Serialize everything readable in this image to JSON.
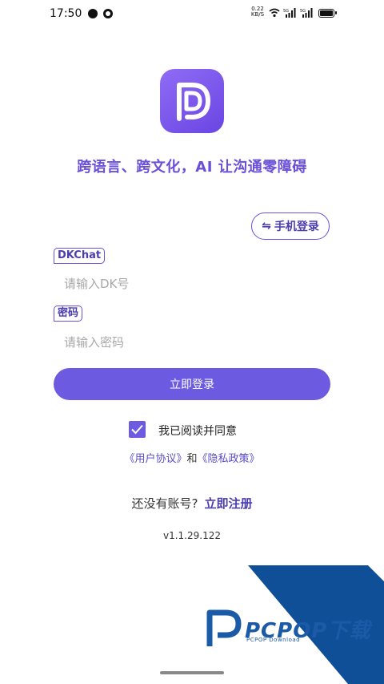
{
  "status_bar": {
    "time": "17:50",
    "net_speed": "0.22",
    "net_unit": "KB/S",
    "sig1_label": "5G",
    "sig2_label": "5G"
  },
  "logo": {
    "icon": "dk-logo-icon",
    "color_start": "#8f6cf5",
    "color_end": "#6a45e3"
  },
  "slogan": "跨语言、跨文化，AI 让沟通零障碍",
  "phone_login": {
    "icon": "swap-icon",
    "label": "手机登录"
  },
  "account": {
    "label": "DKChat",
    "placeholder": "请输入DK号",
    "value": ""
  },
  "password": {
    "label": "密码",
    "placeholder": "请输入密码",
    "value": ""
  },
  "login_button": "立即登录",
  "agreement": {
    "checked": true,
    "text": "我已阅读并同意"
  },
  "policy": {
    "user_agreement": "《用户协议》",
    "and": "和",
    "privacy_policy": "《隐私政策》"
  },
  "register": {
    "prompt": "还没有账号?",
    "link": "立即注册"
  },
  "version": "v1.1.29.122",
  "watermark": {
    "name": "PCPOP下载",
    "sub": "PCPOP Download"
  },
  "colors": {
    "accent": "#6c5ae0",
    "accent_dark": "#4a3db0",
    "watermark": "#1b5aa6"
  }
}
